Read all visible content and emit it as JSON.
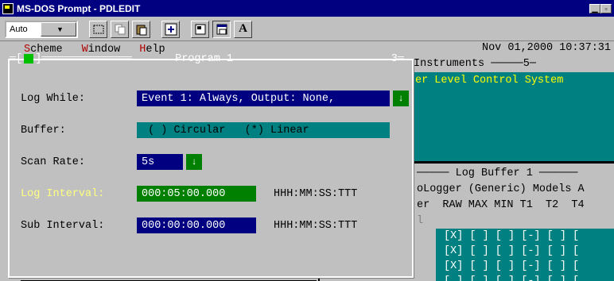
{
  "window": {
    "title": "MS-DOS Prompt - PDLEDIT"
  },
  "toolbar": {
    "font_size": "Auto",
    "font_button": "A"
  },
  "menu": [
    {
      "label": "Scheme",
      "hot": "S",
      "rest": "cheme"
    },
    {
      "label": "Window",
      "hot": "W",
      "rest": "indow"
    },
    {
      "label": "Help",
      "hot": "H",
      "rest": "elp"
    }
  ],
  "datetime": "Nov 01,2000 10:37:31",
  "instruments": {
    "header": "Instruments ─────5─",
    "line": "er Level Control System"
  },
  "program": {
    "header_left": "═[",
    "header_mid": "]══════════════",
    "title": " Program 1 ",
    "number": "3═",
    "log_while": {
      "label": "Log While:",
      "value": "Event 1: Always, Output: None, "
    },
    "buffer": {
      "label": "Buffer:",
      "value": " ( ) Circular   (*) Linear       "
    },
    "scan_rate": {
      "label": "Scan Rate:",
      "value": "5s     "
    },
    "log_interval": {
      "label": "Log Interval:",
      "value": "000:05:00.000 ",
      "format": "HHH:MM:SS:TTT"
    },
    "sub_interval": {
      "label": "Sub Interval:",
      "value": "000:00:00.000 ",
      "format": "HHH:MM:SS:TTT"
    }
  },
  "log_buffer": {
    "header": "───── Log Buffer 1 ──────",
    "line1": "oLogger (Generic) Models A",
    "cols": "er  RAW MAX MIN T1  T2  T4",
    "rows": [
      "[X] [ ] [ ] [-] [ ] [",
      "[X] [ ] [ ] [-] [ ] [",
      "[X] [ ] [ ] [-] [ ] [",
      "[ ] [ ] [ ] [-] [ ] ["
    ],
    "side_char": "l"
  },
  "colors": {
    "title_bg": "#000080",
    "dos_blue": "#000080",
    "dos_teal": "#008080",
    "dos_green": "#008000",
    "dos_yellow": "#ffff00"
  }
}
